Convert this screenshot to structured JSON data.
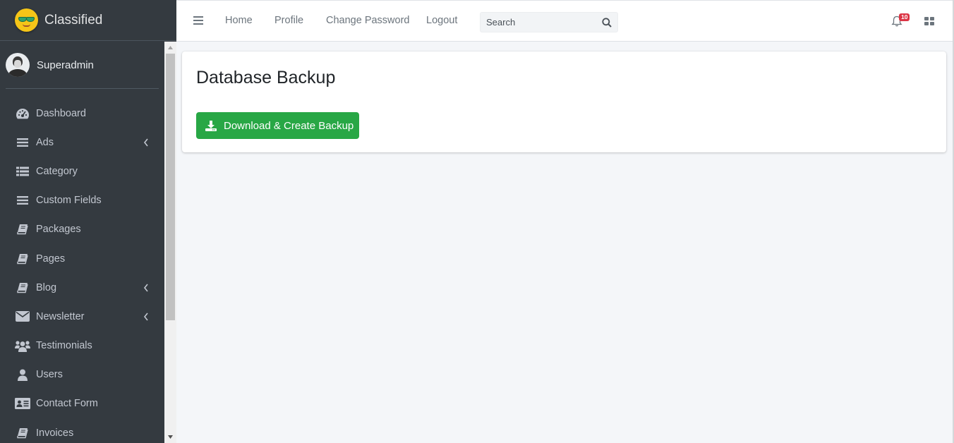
{
  "brand": {
    "name": "Classified"
  },
  "user": {
    "name": "Superadmin"
  },
  "sidebar": {
    "items": [
      {
        "label": "Dashboard",
        "icon": "tachometer-icon",
        "has_arrow": false
      },
      {
        "label": "Ads",
        "icon": "bars-icon",
        "has_arrow": true
      },
      {
        "label": "Category",
        "icon": "list-icon",
        "has_arrow": false
      },
      {
        "label": "Custom Fields",
        "icon": "bars-icon",
        "has_arrow": false
      },
      {
        "label": "Packages",
        "icon": "book-icon",
        "has_arrow": false
      },
      {
        "label": "Pages",
        "icon": "book-icon",
        "has_arrow": false
      },
      {
        "label": "Blog",
        "icon": "book-icon",
        "has_arrow": true
      },
      {
        "label": "Newsletter",
        "icon": "envelope-icon",
        "has_arrow": true
      },
      {
        "label": "Testimonials",
        "icon": "users-icon",
        "has_arrow": false
      },
      {
        "label": "Users",
        "icon": "user-icon",
        "has_arrow": false
      },
      {
        "label": "Contact Form",
        "icon": "id-card-icon",
        "has_arrow": false
      },
      {
        "label": "Invoices",
        "icon": "book-icon",
        "has_arrow": false
      }
    ]
  },
  "navbar": {
    "links": [
      "Home",
      "Profile",
      "Change Password",
      "Logout"
    ],
    "search_placeholder": "Search",
    "notification_count": "10"
  },
  "main": {
    "title": "Database Backup",
    "backup_button_label": "Download & Create Backup"
  },
  "colors": {
    "sidebar_bg": "#343a40",
    "success": "#28a745",
    "danger": "#dc3545",
    "content_bg": "#f4f6f9"
  }
}
